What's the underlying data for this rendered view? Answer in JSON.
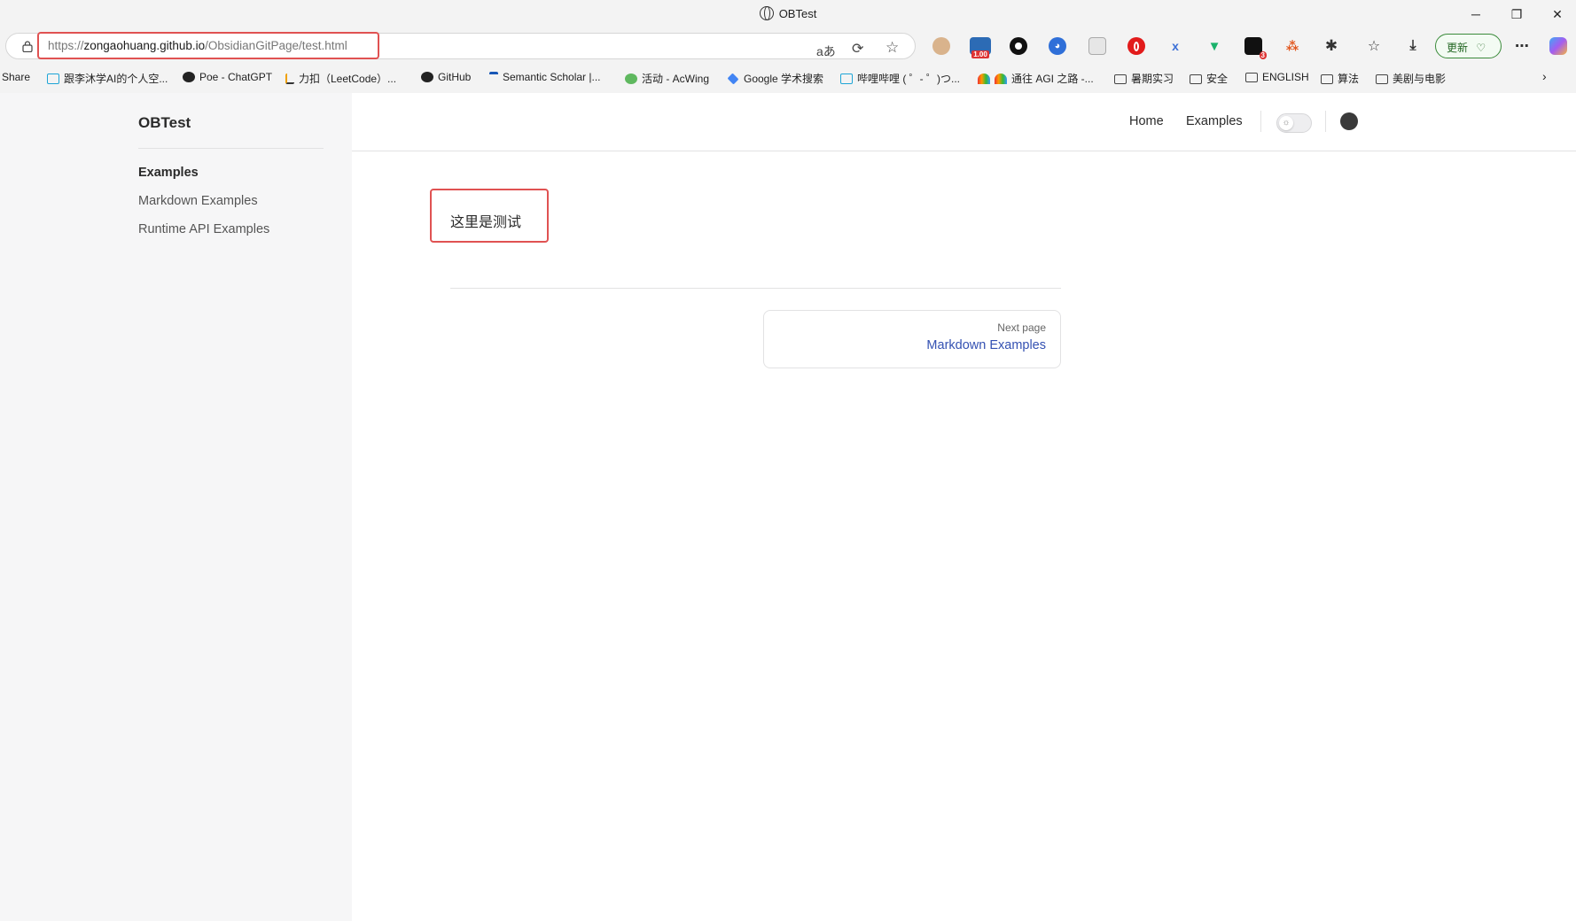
{
  "window": {
    "title": "OBTest",
    "controls": {
      "minimize": "─",
      "restore": "❐",
      "close": "✕"
    }
  },
  "address_bar": {
    "url_prefix": "https://",
    "url_host": "zongaohuang.github.io",
    "url_path": "/ObsidianGitPage/test.html",
    "read_aloud_icon": "aあ",
    "update_button": "更新"
  },
  "extension_badges": {
    "speed": "1.00",
    "count": "3"
  },
  "bookmarks": [
    {
      "label": "Share",
      "icon": "share-icon"
    },
    {
      "label": "跟李沐学AI的个人空...",
      "icon": "bilibili-icon"
    },
    {
      "label": "Poe - ChatGPT",
      "icon": "poe-icon"
    },
    {
      "label": "力扣（LeetCode）...",
      "icon": "leetcode-icon"
    },
    {
      "label": "GitHub",
      "icon": "github-icon"
    },
    {
      "label": "Semantic Scholar |...",
      "icon": "semantic-scholar-icon"
    },
    {
      "label": "活动 - AcWing",
      "icon": "acwing-icon"
    },
    {
      "label": "Google 学术搜索",
      "icon": "google-scholar-icon"
    },
    {
      "label": "哔哩哔哩 ( ゜- ゜)つ...",
      "icon": "bilibili-icon"
    },
    {
      "label": "通往 AGI 之路 -...",
      "icon": "rainbow-icon"
    },
    {
      "label": "暑期实习",
      "icon": "folder-icon"
    },
    {
      "label": "安全",
      "icon": "folder-icon"
    },
    {
      "label": "ENGLISH",
      "icon": "folder-icon"
    },
    {
      "label": "算法",
      "icon": "folder-icon"
    },
    {
      "label": "美剧与电影",
      "icon": "folder-icon"
    }
  ],
  "site": {
    "title": "OBTest",
    "sidebar": {
      "group": "Examples",
      "links": [
        "Markdown Examples",
        "Runtime API Examples"
      ]
    },
    "nav": {
      "home": "Home",
      "examples": "Examples"
    },
    "content": {
      "text": "这里是测试"
    },
    "pager": {
      "label": "Next page",
      "title": "Markdown Examples"
    }
  },
  "colors": {
    "highlight": "#e05252",
    "link": "#3451b2",
    "sidebar_bg": "#f6f6f7"
  }
}
